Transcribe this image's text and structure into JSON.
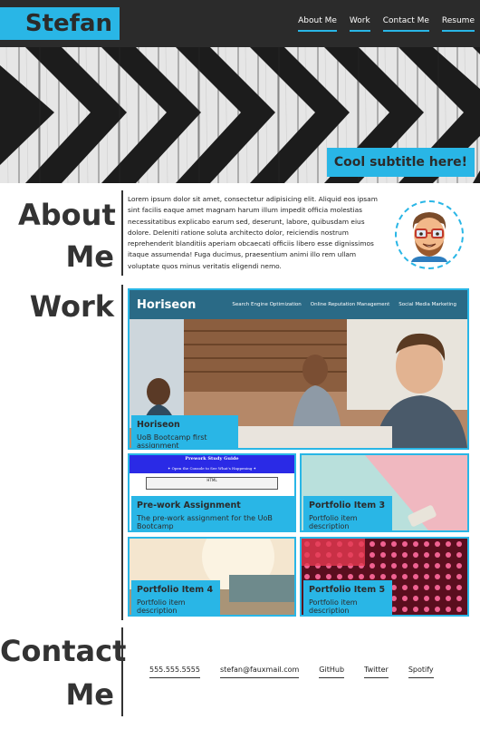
{
  "header": {
    "brand": "Stefan",
    "nav": [
      "About Me",
      "Work",
      "Contact Me",
      "Resume"
    ]
  },
  "hero": {
    "subtitle": "Cool subtitle here!"
  },
  "about": {
    "heading_line1": "About",
    "heading_line2": "Me",
    "text": "Lorem ipsum dolor sit amet, consectetur adipisicing elit. Aliquid eos ipsam sint facilis eaque amet magnam harum illum impedit officia molestias necessitatibus explicabo earum sed, deserunt, labore, quibusdam eius dolore. Deleniti ratione soluta architecto dolor, reiciendis nostrum reprehenderit blanditiis aperiam obcaecati officiis libero esse dignissimos itaque assumenda! Fuga ducimus, praesentium animi illo rem ullam voluptate quos minus veritatis eligendi nemo."
  },
  "work": {
    "heading": "Work",
    "featured": {
      "site_logo": "Horiseon",
      "site_nav": [
        "Search Engine Optimization",
        "Online Reputation Management",
        "Social Media Marketing"
      ],
      "title": "Horiseon",
      "description": "UoB Bootcamp first assignment"
    },
    "items": [
      {
        "title": "Pre-work Assignment",
        "description": "The pre-work assignment for the UoB Bootcamp",
        "thumb_title": "Prework Study Guide",
        "thumb_sub": "✦ Open the Console to See What's Happening ✦",
        "thumb_box": "HTML"
      },
      {
        "title": "Portfolio Item 3",
        "description": "Portfolio item description"
      },
      {
        "title": "Portfolio Item 4",
        "description": "Portfolio item description"
      },
      {
        "title": "Portfolio Item 5",
        "description": "Portfolio item description"
      }
    ]
  },
  "contact": {
    "heading_line1": "Contact",
    "heading_line2": "Me",
    "links": [
      "555.555.5555",
      "stefan@fauxmail.com",
      "GitHub",
      "Twitter",
      "Spotify"
    ]
  },
  "colors": {
    "accent": "#29b6e6",
    "header_bg": "#2b2b2b"
  }
}
